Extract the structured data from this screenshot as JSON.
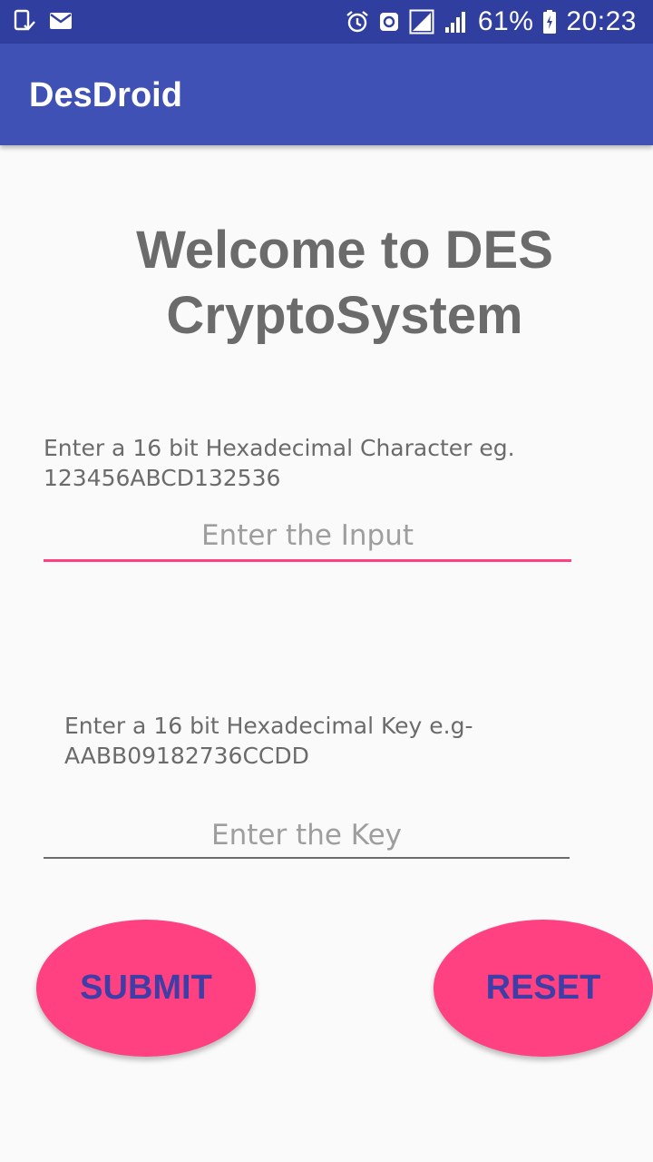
{
  "status_bar": {
    "battery_percent": "61%",
    "time": "20:23",
    "left_icons": [
      "device-check-icon",
      "email-icon"
    ],
    "right_icons": [
      "alarm-icon",
      "data-saver-icon",
      "signal-no-sim-icon",
      "cell-signal-icon",
      "battery-charging-icon"
    ]
  },
  "app_bar": {
    "title": "DesDroid"
  },
  "main": {
    "welcome": "Welcome to DES CryptoSystem",
    "input_hint": "Enter a 16 bit Hexadecimal Character eg. 123456ABCD132536",
    "input_placeholder": "Enter the Input",
    "key_hint": "Enter a 16 bit Hexadecimal Key e.g- AABB09182736CCDD",
    "key_placeholder": "Enter the Key",
    "submit_label": "SUBMIT",
    "reset_label": "RESET"
  },
  "colors": {
    "status_bar": "#303f9f",
    "app_bar": "#3f51b5",
    "accent": "#ff4081",
    "button_text": "#3f3ea6"
  }
}
